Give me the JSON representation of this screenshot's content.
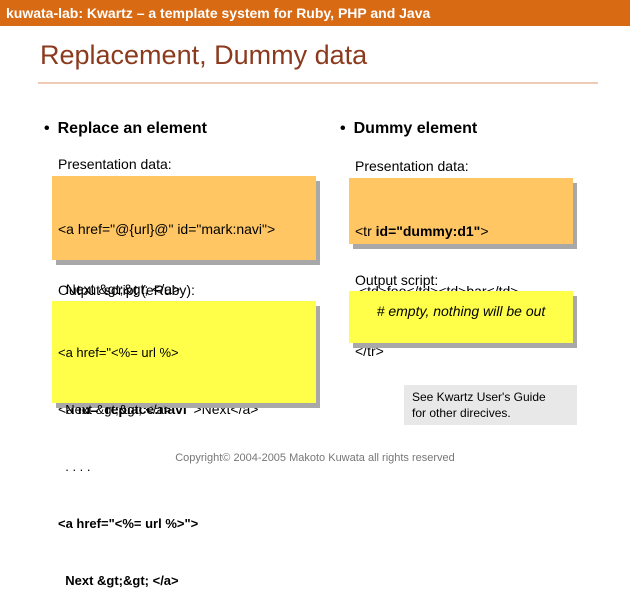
{
  "header": {
    "text": "kuwata-lab:  Kwartz – a template system for Ruby, PHP and Java"
  },
  "title": "Replacement, Dummy data",
  "left": {
    "bullet": "Replace an element",
    "presentation_label": "Presentation data:",
    "presentation_lines": [
      {
        "pre": "<a href=\"@{url}@\" id=\"mark:navi\">",
        "bold": "",
        "post": ""
      },
      {
        "pre": "  Next &gt;&gt; </a>",
        "bold": "",
        "post": ""
      },
      {
        "pre": "  . . . .",
        "bold": "",
        "post": ""
      },
      {
        "pre": "<a ",
        "bold": "id=\"replace:navi\"",
        "post": ">Next</a>"
      }
    ],
    "output_label": "Output script (eRuby):",
    "output_lines": [
      {
        "text": "<a href=\"<%= url %>",
        "bold": false
      },
      {
        "text": "  Next &gt;&gt; </a>",
        "bold": false
      },
      {
        "text": "  . . . .",
        "bold": false
      },
      {
        "text": "<a href=\"<%= url %>\">",
        "bold": true
      },
      {
        "text": "  Next &gt;&gt; </a>",
        "bold": true
      }
    ]
  },
  "right": {
    "bullet": "Dummy element",
    "presentation_label": "Presentation data:",
    "presentation_lines": [
      {
        "pre": "<tr ",
        "bold": "id=\"dummy:d1\"",
        "post": ">"
      },
      {
        "pre": " <td>foo</td><td>bar</td>",
        "bold": "",
        "post": ""
      },
      {
        "pre": "</tr>",
        "bold": "",
        "post": ""
      }
    ],
    "output_label": "Output script:",
    "output_text": "# empty, nothing will be out"
  },
  "note": {
    "line1": "See Kwartz User's Guide",
    "line2": "for other direcives."
  },
  "footer": "Copyright© 2004-2005 Makoto Kuwata all rights reserved"
}
